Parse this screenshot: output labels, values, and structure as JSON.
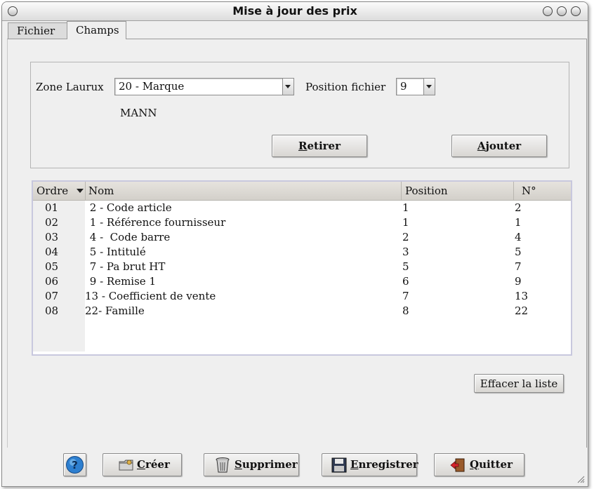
{
  "window": {
    "title": "Mise à jour des prix"
  },
  "tabs": [
    {
      "label": "Fichier"
    },
    {
      "label": "Champs"
    }
  ],
  "form": {
    "zone_label": "Zone Laurux",
    "zone_value": "20 - Marque",
    "position_label": "Position fichier",
    "position_value": "9",
    "preview_text": "MANN",
    "retirer_label_first": "R",
    "retirer_label_rest": "etirer",
    "ajouter_label_first": "A",
    "ajouter_label_rest": "jouter"
  },
  "table": {
    "columns": [
      "Ordre",
      "Nom",
      "Position",
      "N°"
    ],
    "rows": [
      {
        "ordre": "01",
        "nom": " 2 - Code article",
        "position": "1",
        "num": "2"
      },
      {
        "ordre": "02",
        "nom": " 1 - Référence fournisseur",
        "position": "1",
        "num": "1"
      },
      {
        "ordre": "03",
        "nom": " 4 -  Code barre",
        "position": "2",
        "num": "4"
      },
      {
        "ordre": "04",
        "nom": " 5 - Intitulé",
        "position": "3",
        "num": "5"
      },
      {
        "ordre": "05",
        "nom": " 7 - Pa brut HT",
        "position": "5",
        "num": "7"
      },
      {
        "ordre": "06",
        "nom": " 9 - Remise 1",
        "position": "6",
        "num": "9"
      },
      {
        "ordre": "07",
        "nom": "13 - Coefficient de vente",
        "position": "7",
        "num": "13"
      },
      {
        "ordre": "08",
        "nom": "22- Famille",
        "position": "8",
        "num": "22"
      }
    ]
  },
  "effacer_label": "Effacer la liste",
  "toolbar": {
    "creer_first": "C",
    "creer_rest": "réer",
    "supprimer_first": "S",
    "supprimer_rest": "upprimer",
    "enregistrer_first": "E",
    "enregistrer_rest": "nregistrer",
    "quitter_first": "Q",
    "quitter_rest": "uitter"
  },
  "icons": {
    "help": "help-icon",
    "creer": "folder-icon",
    "supprimer": "trash-icon",
    "enregistrer": "floppy-disk-icon",
    "quitter": "exit-door-icon"
  },
  "colors": {
    "accent": "#2d7fd0",
    "grid_border": "#c8c8de",
    "header_bg": "#dcd9d3"
  }
}
